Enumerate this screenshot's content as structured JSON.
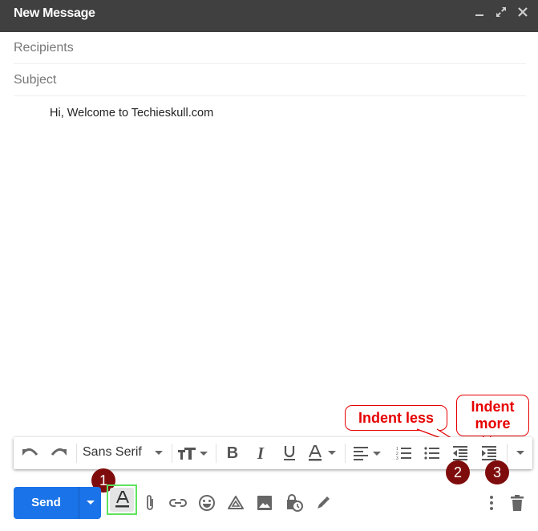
{
  "window": {
    "title": "New Message",
    "controls": {
      "minimize": "minimize",
      "expand": "expand",
      "close": "close"
    }
  },
  "fields": {
    "recipients": {
      "placeholder": "Recipients",
      "value": ""
    },
    "subject": {
      "placeholder": "Subject",
      "value": ""
    }
  },
  "message": {
    "body": "Hi, Welcome to Techieskull.com"
  },
  "toolbar": {
    "font": "Sans Serif",
    "items": [
      "undo",
      "redo",
      "font",
      "font-size",
      "bold",
      "italic",
      "underline",
      "text-color",
      "align",
      "numbered-list",
      "bulleted-list",
      "indent-less",
      "indent-more",
      "more-formatting"
    ]
  },
  "bottom_bar": {
    "send_label": "Send",
    "items": [
      "formatting-options",
      "attach-files",
      "insert-link",
      "insert-emoji",
      "insert-drive",
      "insert-photo",
      "confidential-mode",
      "insert-signature",
      "more-options",
      "discard-draft"
    ]
  },
  "annotations": {
    "callout_indent_less": "Indent less",
    "callout_indent_more_1": "Indent",
    "callout_indent_more_2": "more",
    "badge_1": "1",
    "badge_2": "2",
    "badge_3": "3"
  },
  "colors": {
    "header_bg": "#404040",
    "send_blue": "#1a73e8",
    "annotation_red": "#e60000",
    "badge_bg": "#7f0c0c",
    "highlight_green": "#5ee35e"
  }
}
